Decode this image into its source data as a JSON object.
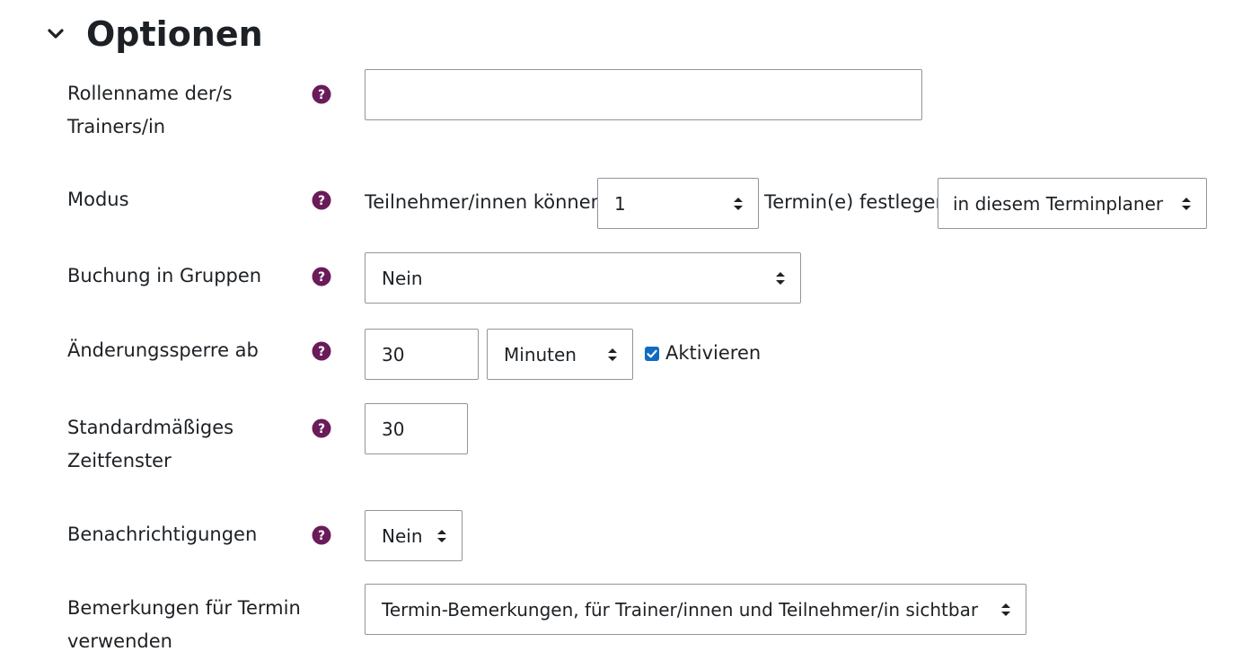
{
  "section": {
    "title": "Optionen"
  },
  "fields": {
    "role_name": {
      "label": "Rollenname der/s Trainers/in",
      "value": ""
    },
    "mode": {
      "label": "Modus",
      "prefix": "Teilnehmer/innen können",
      "count": "1",
      "middle": "Termin(e) festlegen",
      "scope": "in diesem Terminplaner"
    },
    "group_booking": {
      "label": "Buchung in Gruppen",
      "value": "Nein"
    },
    "change_lock": {
      "label": "Änderungssperre ab",
      "value": "30",
      "unit": "Minuten",
      "enable_label": "Aktivieren",
      "enabled": true
    },
    "default_slot": {
      "label": "Standardmäßiges Zeitfenster",
      "value": "30"
    },
    "notifications": {
      "label": "Benachrichtigungen",
      "value": "Nein"
    },
    "notes": {
      "label": "Bemerkungen für Termin verwenden",
      "value": "Termin-Bemerkungen, für Trainer/innen und Teilnehmer/in sichtbar"
    }
  },
  "icons": {
    "collapse": "chevron-down-icon",
    "help": "question-circle-icon"
  },
  "colors": {
    "help_icon": "#6a1b59",
    "checkbox": "#0f6cbf",
    "border": "#8f959e",
    "text": "#1d2125"
  }
}
